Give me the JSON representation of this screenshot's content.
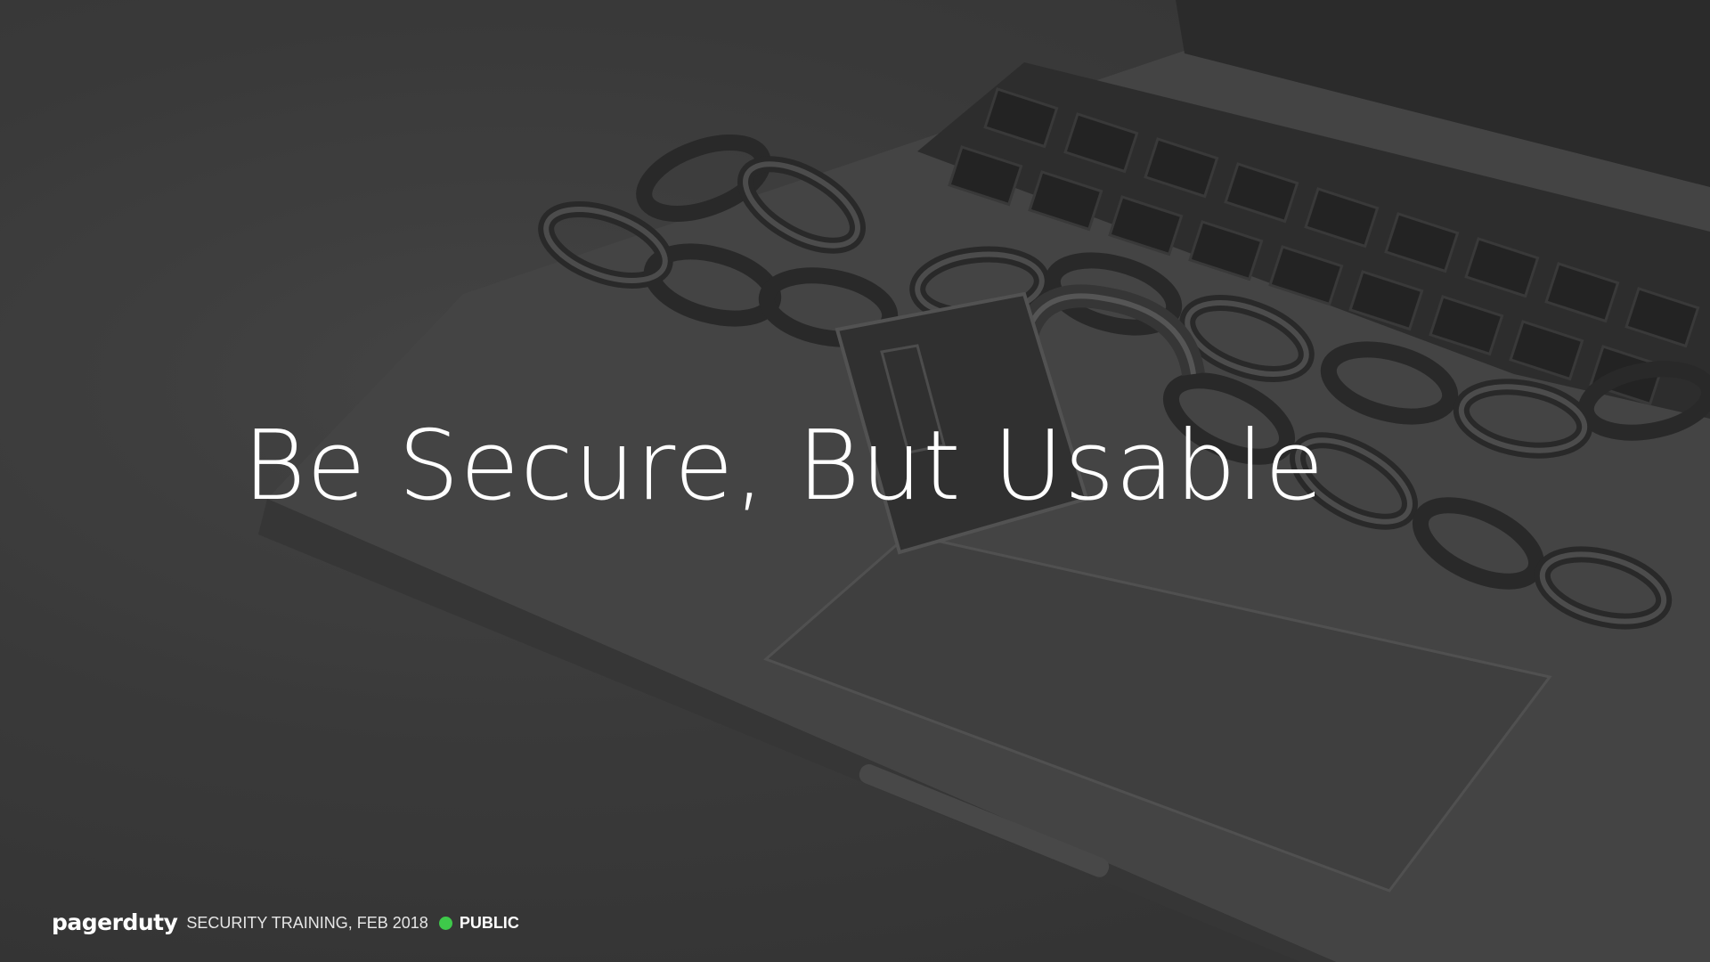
{
  "slide": {
    "title": "Be Secure, But Usable",
    "background_image": "laptop-chained-padlock-photo"
  },
  "footer": {
    "logo_text": "pagerduty",
    "event_text": "SECURITY TRAINING, FEB 2018",
    "visibility_label": "PUBLIC",
    "status_color": "#3ec94a"
  },
  "colors": {
    "title_text": "#ffffff",
    "background": "#3b3b3b"
  }
}
